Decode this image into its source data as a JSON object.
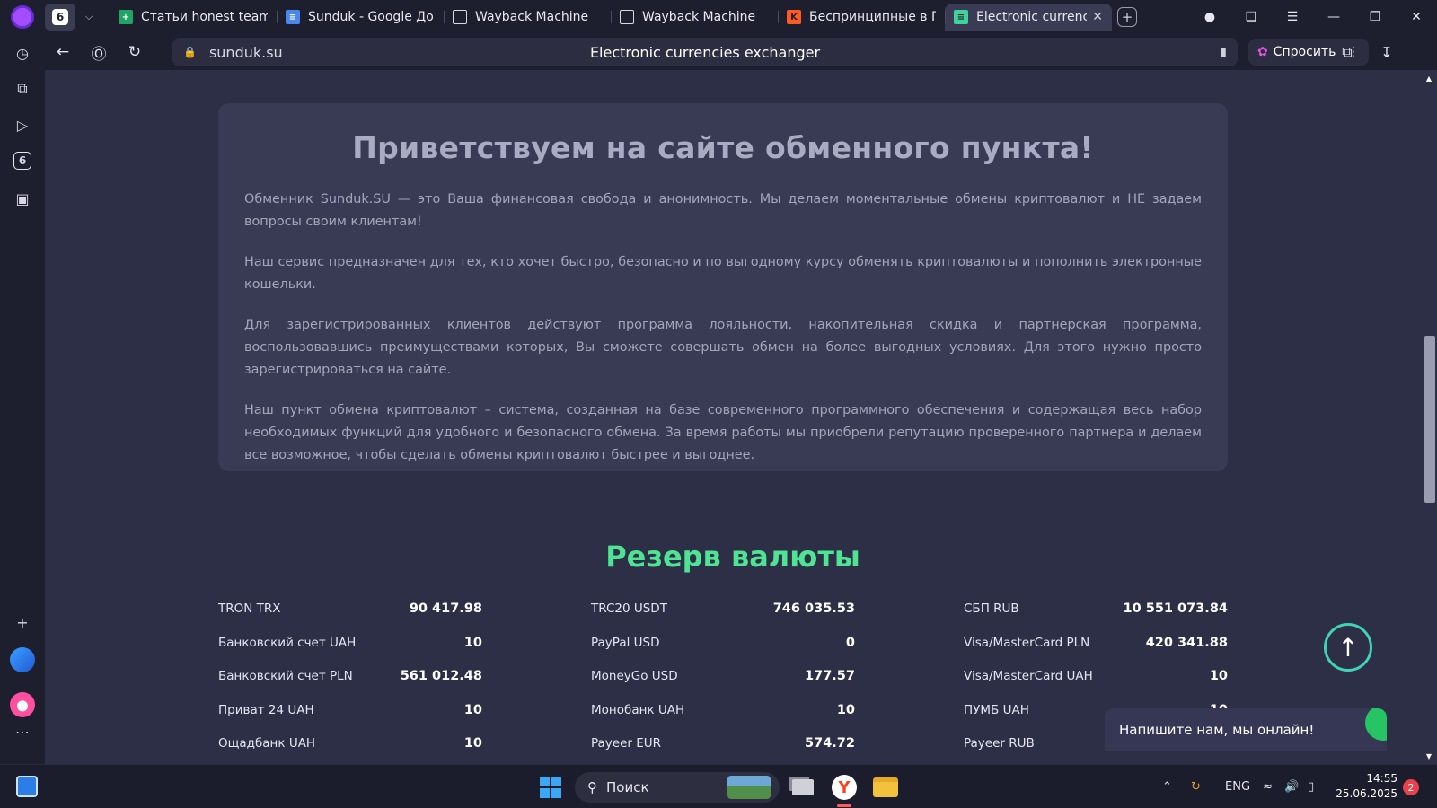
{
  "browser": {
    "tab_count": "6",
    "tabs": [
      {
        "label": "Статьи honest team - С",
        "icon": "google-sheets-icon",
        "active": false
      },
      {
        "label": "Sunduk - Google Доку",
        "icon": "google-docs-icon",
        "active": false
      },
      {
        "label": "Wayback Machine",
        "icon": "page-icon",
        "active": false
      },
      {
        "label": "Wayback Machine",
        "icon": "page-icon",
        "active": false
      },
      {
        "label": "Беспринципные в Пит",
        "icon": "kinopoisk-icon",
        "active": false
      },
      {
        "label": "Electronic currencie",
        "icon": "exchanger-favicon",
        "active": true
      }
    ],
    "url_domain": "sunduk.su",
    "page_title": "Electronic currencies exchanger",
    "ask_label": "Спросить"
  },
  "page": {
    "welcome_title": "Приветствуем на сайте обменного пункта!",
    "paragraphs": [
      "Обменник Sunduk.SU — это Ваша финансовая свобода и анонимность. Мы делаем моментальные обмены криптовалют и НЕ задаем вопросы своим клиентам!",
      "Наш сервис предназначен для тех, кто хочет быстро, безопасно и по выгодному курсу обменять криптовалюты и пополнить электронные кошельки.",
      "Для зарегистрированных клиентов действуют программа лояльности, накопительная скидка и партнерская программа, воспользовавшись преимуществами которых, Вы сможете совершать обмен на более выгодных условиях. Для этого нужно просто зарегистрироваться на сайте.",
      "Наш пункт обмена криптовалют – система, созданная на базе современного программного обеспечения и содержащая весь набор необходимых функций для удобного и безопасного обмена. За время работы мы приобрели репутацию проверенного партнера и делаем все возможное, чтобы сделать обмены криптовалют быстрее и выгоднее."
    ],
    "reserve_title": "Резерв валюты",
    "reserve_columns": [
      [
        {
          "name": "TRON TRX",
          "value": "90 417.98"
        },
        {
          "name": "Банковский счет UAH",
          "value": "10"
        },
        {
          "name": "Банковский счет PLN",
          "value": "561 012.48"
        },
        {
          "name": "Приват 24 UAH",
          "value": "10"
        },
        {
          "name": "Ощадбанк UAH",
          "value": "10"
        }
      ],
      [
        {
          "name": "TRC20 USDT",
          "value": "746 035.53"
        },
        {
          "name": "PayPal USD",
          "value": "0"
        },
        {
          "name": "MoneyGo USD",
          "value": "177.57"
        },
        {
          "name": "Монобанк UAH",
          "value": "10"
        },
        {
          "name": "Payeer EUR",
          "value": "574.72"
        }
      ],
      [
        {
          "name": "СБП RUB",
          "value": "10 551 073.84"
        },
        {
          "name": "Visa/MasterCard PLN",
          "value": "420 341.88"
        },
        {
          "name": "Visa/MasterCard UAH",
          "value": "10"
        },
        {
          "name": "ПУМБ UAH",
          "value": "10"
        },
        {
          "name": "Payeer RUB",
          "value": ""
        }
      ]
    ],
    "chat_label": "Напишите нам, мы онлайн!"
  },
  "taskbar": {
    "search_label": "Поиск",
    "language": "ENG",
    "time": "14:55",
    "date": "25.06.2025",
    "notifications": "2"
  },
  "colors": {
    "page_bg": "#2d2f47",
    "card_bg": "#393b55",
    "reserve_title": "#4fe394",
    "accent_teal": "#3fd2b4"
  }
}
